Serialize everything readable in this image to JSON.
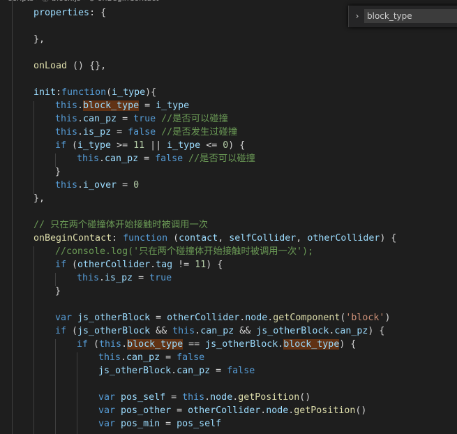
{
  "breadcrumb": {
    "text": "› scripts › ⓙ block.js › ⊙ onBeginContact"
  },
  "find_widget": {
    "toggle_icon": "chevron-right-icon",
    "query": "block_type"
  },
  "colors": {
    "background": "#1e1e1e",
    "keyword": "#569cd6",
    "variable": "#9cdcfe",
    "function": "#dcdcaa",
    "number": "#b5cea8",
    "string": "#ce9178",
    "comment": "#6a9955",
    "match_highlight": "#613214"
  },
  "lines": [
    [
      [
        "var",
        "properties"
      ],
      [
        "pl",
        ": {"
      ]
    ],
    [],
    [
      [
        "pl",
        "},"
      ]
    ],
    [],
    [
      [
        "fn",
        "onLoad"
      ],
      [
        "pl",
        " () {},"
      ]
    ],
    [],
    [
      [
        "var",
        "init"
      ],
      [
        "pl",
        ":"
      ],
      [
        "kw",
        "function"
      ],
      [
        "pl",
        "("
      ],
      [
        "var",
        "i_type"
      ],
      [
        "pl",
        "){"
      ]
    ],
    [
      [
        "kw",
        "this"
      ],
      [
        "pl",
        "."
      ],
      [
        "var hl",
        "block_type"
      ],
      [
        "pl",
        " = "
      ],
      [
        "var",
        "i_type"
      ]
    ],
    [
      [
        "kw",
        "this"
      ],
      [
        "pl",
        "."
      ],
      [
        "var",
        "can_pz"
      ],
      [
        "pl",
        " = "
      ],
      [
        "kw",
        "true"
      ],
      [
        "pl",
        " "
      ],
      [
        "cm",
        "//是否可以碰撞"
      ]
    ],
    [
      [
        "kw",
        "this"
      ],
      [
        "pl",
        "."
      ],
      [
        "var",
        "is_pz"
      ],
      [
        "pl",
        " = "
      ],
      [
        "kw",
        "false"
      ],
      [
        "pl",
        " "
      ],
      [
        "cm",
        "//是否发生过碰撞"
      ]
    ],
    [
      [
        "kw",
        "if"
      ],
      [
        "pl",
        " ("
      ],
      [
        "var",
        "i_type"
      ],
      [
        "pl",
        " >= "
      ],
      [
        "num",
        "11"
      ],
      [
        "pl",
        " || "
      ],
      [
        "var",
        "i_type"
      ],
      [
        "pl",
        " <= "
      ],
      [
        "num",
        "0"
      ],
      [
        "pl",
        ") {"
      ]
    ],
    [
      [
        "kw",
        "this"
      ],
      [
        "pl",
        "."
      ],
      [
        "var",
        "can_pz"
      ],
      [
        "pl",
        " = "
      ],
      [
        "kw",
        "false"
      ],
      [
        "pl",
        " "
      ],
      [
        "cm",
        "//是否可以碰撞"
      ]
    ],
    [
      [
        "pl",
        "}"
      ]
    ],
    [
      [
        "kw",
        "this"
      ],
      [
        "pl",
        "."
      ],
      [
        "var",
        "i_over"
      ],
      [
        "pl",
        " = "
      ],
      [
        "num",
        "0"
      ]
    ],
    [
      [
        "pl",
        "},"
      ]
    ],
    [],
    [
      [
        "cm",
        "// 只在两个碰撞体开始接触时被调用一次"
      ]
    ],
    [
      [
        "fn",
        "onBeginContact"
      ],
      [
        "pl",
        ": "
      ],
      [
        "kw",
        "function"
      ],
      [
        "pl",
        " ("
      ],
      [
        "var",
        "contact"
      ],
      [
        "pl",
        ", "
      ],
      [
        "var",
        "selfCollider"
      ],
      [
        "pl",
        ", "
      ],
      [
        "var",
        "otherCollider"
      ],
      [
        "pl",
        ") {"
      ]
    ],
    [
      [
        "cm",
        "//console.log('只在两个碰撞体开始接触时被调用一次');"
      ]
    ],
    [
      [
        "kw",
        "if"
      ],
      [
        "pl",
        " ("
      ],
      [
        "var",
        "otherCollider"
      ],
      [
        "pl",
        "."
      ],
      [
        "var",
        "tag"
      ],
      [
        "pl",
        " != "
      ],
      [
        "num",
        "11"
      ],
      [
        "pl",
        ") {"
      ]
    ],
    [
      [
        "kw",
        "this"
      ],
      [
        "pl",
        "."
      ],
      [
        "var",
        "is_pz"
      ],
      [
        "pl",
        " = "
      ],
      [
        "kw",
        "true"
      ]
    ],
    [
      [
        "pl",
        "}"
      ]
    ],
    [],
    [
      [
        "kw",
        "var"
      ],
      [
        "pl",
        " "
      ],
      [
        "var",
        "js_otherBlock"
      ],
      [
        "pl",
        " = "
      ],
      [
        "var",
        "otherCollider"
      ],
      [
        "pl",
        "."
      ],
      [
        "var",
        "node"
      ],
      [
        "pl",
        "."
      ],
      [
        "fn",
        "getComponent"
      ],
      [
        "pl",
        "("
      ],
      [
        "str",
        "'block'"
      ],
      [
        "pl",
        ")"
      ]
    ],
    [
      [
        "kw",
        "if"
      ],
      [
        "pl",
        " ("
      ],
      [
        "var",
        "js_otherBlock"
      ],
      [
        "pl",
        " && "
      ],
      [
        "kw",
        "this"
      ],
      [
        "pl",
        "."
      ],
      [
        "var",
        "can_pz"
      ],
      [
        "pl",
        " && "
      ],
      [
        "var",
        "js_otherBlock"
      ],
      [
        "pl",
        "."
      ],
      [
        "var",
        "can_pz"
      ],
      [
        "pl",
        ") {"
      ]
    ],
    [
      [
        "kw",
        "if"
      ],
      [
        "pl",
        " ("
      ],
      [
        "kw",
        "this"
      ],
      [
        "pl",
        "."
      ],
      [
        "var hl",
        "block_type"
      ],
      [
        "pl",
        " == "
      ],
      [
        "var",
        "js_otherBlock"
      ],
      [
        "pl",
        "."
      ],
      [
        "var hl",
        "block_type"
      ],
      [
        "pl",
        ") {"
      ]
    ],
    [
      [
        "kw",
        "this"
      ],
      [
        "pl",
        "."
      ],
      [
        "var",
        "can_pz"
      ],
      [
        "pl",
        " = "
      ],
      [
        "kw",
        "false"
      ]
    ],
    [
      [
        "var",
        "js_otherBlock"
      ],
      [
        "pl",
        "."
      ],
      [
        "var",
        "can_pz"
      ],
      [
        "pl",
        " = "
      ],
      [
        "kw",
        "false"
      ]
    ],
    [],
    [
      [
        "kw",
        "var"
      ],
      [
        "pl",
        " "
      ],
      [
        "var",
        "pos_self"
      ],
      [
        "pl",
        " = "
      ],
      [
        "kw",
        "this"
      ],
      [
        "pl",
        "."
      ],
      [
        "var",
        "node"
      ],
      [
        "pl",
        "."
      ],
      [
        "fn",
        "getPosition"
      ],
      [
        "pl",
        "()"
      ]
    ],
    [
      [
        "kw",
        "var"
      ],
      [
        "pl",
        " "
      ],
      [
        "var",
        "pos_other"
      ],
      [
        "pl",
        " = "
      ],
      [
        "var",
        "otherCollider"
      ],
      [
        "pl",
        "."
      ],
      [
        "var",
        "node"
      ],
      [
        "pl",
        "."
      ],
      [
        "fn",
        "getPosition"
      ],
      [
        "pl",
        "()"
      ]
    ],
    [
      [
        "kw",
        "var"
      ],
      [
        "pl",
        " "
      ],
      [
        "var",
        "pos_min"
      ],
      [
        "pl",
        " = "
      ],
      [
        "var",
        "pos_self"
      ]
    ]
  ]
}
